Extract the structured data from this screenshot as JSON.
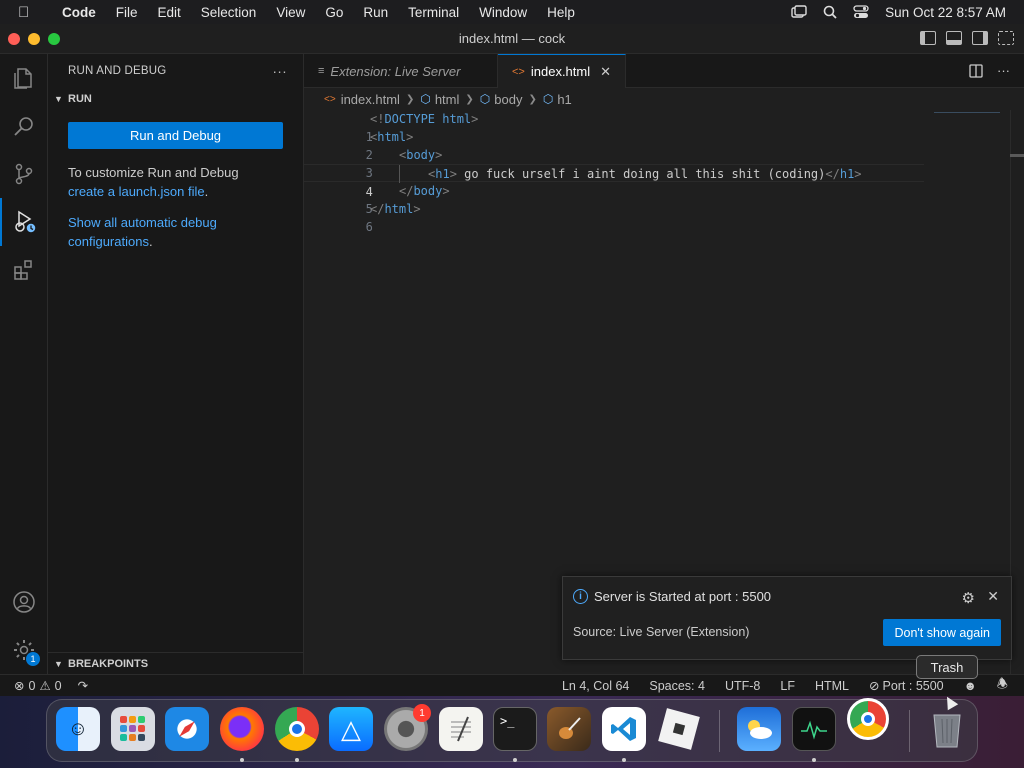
{
  "menubar": {
    "app_name": "Code",
    "items": [
      "File",
      "Edit",
      "Selection",
      "View",
      "Go",
      "Run",
      "Terminal",
      "Window",
      "Help"
    ],
    "datetime": "Sun Oct 22  8:57 AM"
  },
  "window": {
    "title": "index.html — cock"
  },
  "sidebar": {
    "title": "RUN AND DEBUG",
    "section_run": "RUN",
    "run_button": "Run and Debug",
    "customize_text": "To customize Run and Debug",
    "launch_link": "create a launch.json file",
    "period1": ".",
    "show_link": "Show all automatic debug configurations",
    "period2": ".",
    "breakpoints": "BREAKPOINTS"
  },
  "activity": {
    "settings_badge": "1"
  },
  "tabs": [
    {
      "label": "Extension: Live Server"
    },
    {
      "label": "index.html"
    }
  ],
  "breadcrumb": [
    "index.html",
    "html",
    "body",
    "h1"
  ],
  "editor": {
    "line_numbers": [
      "1",
      "2",
      "3",
      "4",
      "5",
      "6"
    ],
    "lines": {
      "l1": {
        "open": "<!",
        "name": "DOCTYPE",
        "rest": " html",
        "close": ">"
      },
      "l2": {
        "open": "<",
        "name": "html",
        "close": ">"
      },
      "l3": {
        "open": "<",
        "name": "body",
        "close": ">"
      },
      "l4": {
        "open": "<",
        "name": "h1",
        "close": ">",
        "text": " go fuck urself i aint doing all this shit (coding)",
        "end_open": "</",
        "end_name": "h1",
        "end_close": ">"
      },
      "l5": {
        "open": "</",
        "name": "body",
        "close": ">"
      },
      "l6": {
        "open": "</",
        "name": "html",
        "close": ">"
      }
    }
  },
  "notification": {
    "message": "Server is Started at port : 5500",
    "source": "Source: Live Server (Extension)",
    "button": "Don't show again"
  },
  "statusbar": {
    "errors": "0",
    "warnings": "0",
    "position": "Ln 4, Col 64",
    "spaces": "Spaces: 4",
    "encoding": "UTF-8",
    "eol": "LF",
    "language": "HTML",
    "port": "Port : 5500"
  },
  "tooltip": "Trash",
  "dock": {
    "settings_badge": "1",
    "apps": [
      "Finder",
      "Launchpad",
      "Safari",
      "Firefox",
      "Chrome",
      "App Store",
      "System Settings",
      "TextEdit",
      "Terminal",
      "GarageBand",
      "Visual Studio Code",
      "Roblox",
      "Weather",
      "Activity Monitor",
      "Chrome",
      "Trash"
    ]
  },
  "colors": {
    "accent": "#0078d4",
    "link": "#4daafc",
    "html_icon": "#e37933"
  }
}
